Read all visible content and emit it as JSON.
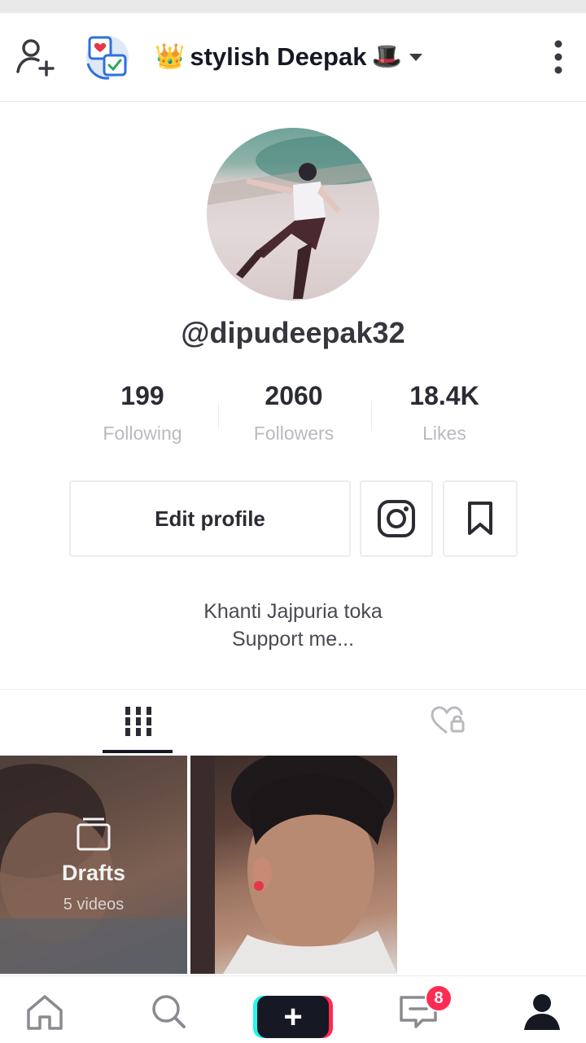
{
  "header": {
    "title_prefix_emoji": "👑",
    "title": "stylish Deepak",
    "title_suffix_emoji": "🎩",
    "icons": [
      "add-user-icon",
      "switch-app-icon",
      "chevron-down-icon",
      "more-icon"
    ]
  },
  "profile": {
    "username": "@dipudeepak32",
    "stats": [
      {
        "value": "199",
        "label": "Following"
      },
      {
        "value": "2060",
        "label": "Followers"
      },
      {
        "value": "18.4K",
        "label": "Likes"
      }
    ],
    "edit_label": "Edit profile",
    "bio_line1": "Khanti Jajpuria toka",
    "bio_line2": "Support me..."
  },
  "tabs": [
    {
      "name": "videos",
      "icon": "grid-icon",
      "active": true
    },
    {
      "name": "liked",
      "icon": "heart-lock-icon",
      "active": false
    }
  ],
  "grid": {
    "drafts_label": "Drafts",
    "drafts_count": "5 videos"
  },
  "bottom_nav": {
    "inbox_badge": "8",
    "items": [
      "home-icon",
      "discover-icon",
      "create-icon",
      "inbox-icon",
      "me-icon"
    ]
  },
  "colors": {
    "accent_red": "#fe2c55",
    "accent_cyan": "#25f4ee",
    "text_primary": "#161823",
    "text_muted": "#b9bac0"
  }
}
